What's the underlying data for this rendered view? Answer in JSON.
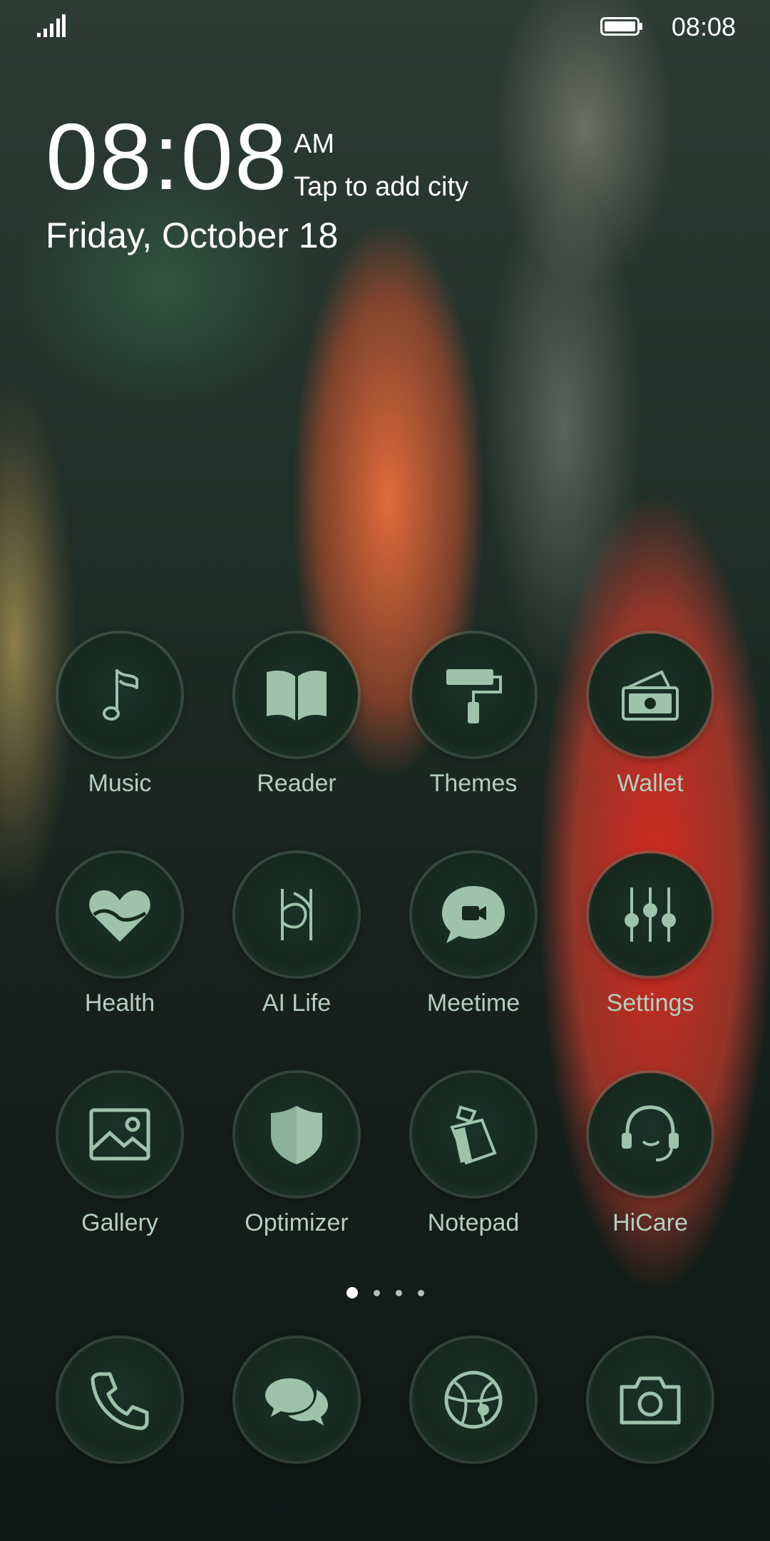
{
  "status_bar": {
    "time": "08:08",
    "icons": [
      "signal-icon",
      "battery-icon"
    ]
  },
  "clock_widget": {
    "time": "08:08",
    "ampm": "AM",
    "city_prompt": "Tap to add city",
    "date": "Friday, October 18"
  },
  "apps": [
    {
      "label": "Music",
      "icon": "music-note-icon"
    },
    {
      "label": "Reader",
      "icon": "book-icon"
    },
    {
      "label": "Themes",
      "icon": "paint-roller-icon"
    },
    {
      "label": "Wallet",
      "icon": "wallet-icon"
    },
    {
      "label": "Health",
      "icon": "heart-icon"
    },
    {
      "label": "AI Life",
      "icon": "ai-life-icon"
    },
    {
      "label": "Meetime",
      "icon": "video-chat-icon"
    },
    {
      "label": "Settings",
      "icon": "sliders-icon"
    },
    {
      "label": "Gallery",
      "icon": "image-icon"
    },
    {
      "label": "Optimizer",
      "icon": "shield-icon"
    },
    {
      "label": "Notepad",
      "icon": "notepad-icon"
    },
    {
      "label": "HiCare",
      "icon": "headset-icon"
    }
  ],
  "page_indicator": {
    "pages": 4,
    "current": 1
  },
  "dock": [
    {
      "icon": "phone-icon"
    },
    {
      "icon": "messages-icon"
    },
    {
      "icon": "browser-icon"
    },
    {
      "icon": "camera-icon"
    }
  ],
  "colors": {
    "icon_fill": "#9fc2ad",
    "label": "#b4cfbf",
    "icon_bg": "#17291f"
  }
}
